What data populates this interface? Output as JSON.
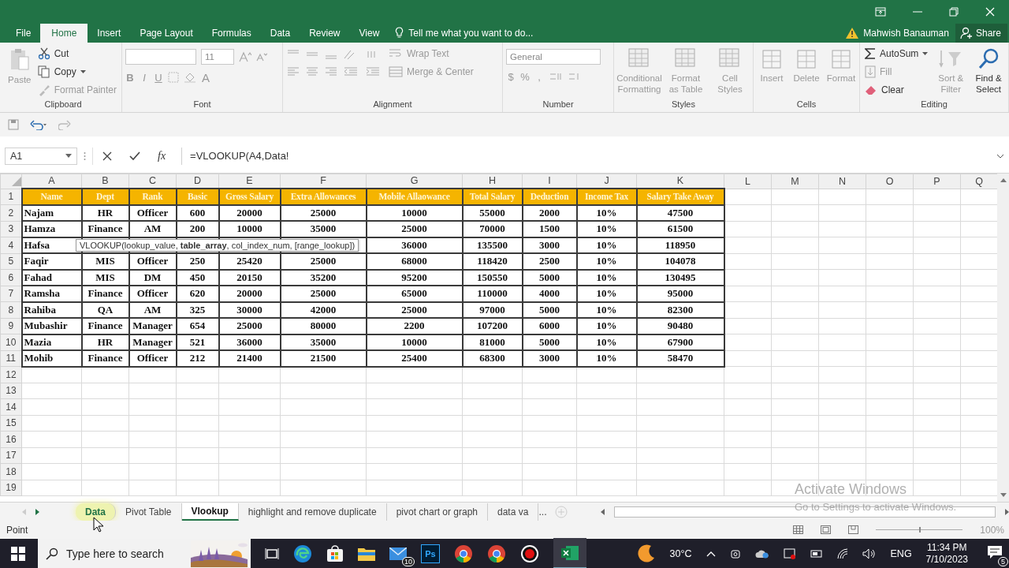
{
  "ribbon_tabs": [
    {
      "label": "File",
      "selected": false
    },
    {
      "label": "Home",
      "selected": true
    },
    {
      "label": "Insert",
      "selected": false
    },
    {
      "label": "Page Layout",
      "selected": false
    },
    {
      "label": "Formulas",
      "selected": false
    },
    {
      "label": "Data",
      "selected": false
    },
    {
      "label": "Review",
      "selected": false
    },
    {
      "label": "View",
      "selected": false
    }
  ],
  "tell_me": "Tell me what you want to do...",
  "user": "Mahwish Banauman",
  "share": "Share",
  "ribbon": {
    "clipboard": {
      "label": "Clipboard",
      "paste": {
        "label": "Paste",
        "disabled": true
      },
      "cut": {
        "label": "Cut",
        "disabled": false
      },
      "copy": {
        "label": "Copy",
        "disabled": false
      },
      "format_painter": {
        "label": "Format Painter",
        "disabled": true
      }
    },
    "font": {
      "label": "Font",
      "font_size": "11",
      "bold": "B",
      "italic": "I",
      "underline": "U",
      "font_color": "A"
    },
    "alignment": {
      "label": "Alignment",
      "wrap_text": "Wrap Text",
      "merge_center": "Merge & Center"
    },
    "number": {
      "label": "Number",
      "format": "General",
      "currency": "$",
      "percent": "%",
      "comma": ","
    },
    "styles": {
      "label": "Styles",
      "commands": [
        "Conditional Formatting",
        "Format as Table",
        "Cell Styles"
      ]
    },
    "cells": {
      "label": "Cells",
      "commands": [
        "Insert",
        "Delete",
        "Format"
      ]
    },
    "editing": {
      "label": "Editing",
      "autosum": {
        "label": "AutoSum",
        "disabled": false
      },
      "fill": {
        "label": "Fill",
        "disabled": true
      },
      "clear": {
        "label": "Clear",
        "disabled": false
      },
      "sort_filter": {
        "label": "Sort & Filter",
        "disabled": true
      },
      "find_select": {
        "label": "Find & Select",
        "disabled": false
      }
    }
  },
  "formula_bar": {
    "name_box": "A1",
    "function_label": "fx",
    "formula": "=VLOOKUP(A4,Data!"
  },
  "tooltip": "VLOOKUP(lookup_value, **table_array**, col_index_num, [range_lookup])",
  "sheet": {
    "columns": [
      "A",
      "B",
      "C",
      "D",
      "E",
      "F",
      "G",
      "H",
      "I",
      "J",
      "K",
      "L",
      "M",
      "N",
      "O",
      "P",
      "Q"
    ],
    "row_numbers": [
      "1",
      "2",
      "3",
      "4",
      "5",
      "6",
      "7",
      "8",
      "9",
      "10",
      "11",
      "12",
      "13",
      "14",
      "15",
      "16",
      "17",
      "18",
      "19"
    ],
    "header": [
      "Name",
      "Dept",
      "Rank",
      "Basic",
      "Gross Salary",
      "Extra Allowances",
      "Mobile Allaowance",
      "Total Salary",
      "Deduction",
      "Income Tax",
      "Salary Take Away"
    ],
    "rows": [
      [
        "Najam",
        "HR",
        "Officer",
        "600",
        "20000",
        "25000",
        "10000",
        "55000",
        "2000",
        "10%",
        "47500"
      ],
      [
        "Hamza",
        "Finance",
        "AM",
        "200",
        "10000",
        "35000",
        "25000",
        "70000",
        "1500",
        "10%",
        "61500"
      ],
      [
        "Hafsa",
        null,
        null,
        null,
        null,
        null,
        "36000",
        "135500",
        "3000",
        "10%",
        "118950"
      ],
      [
        "Faqir",
        "MIS",
        "Officer",
        "250",
        "25420",
        "25000",
        "68000",
        "118420",
        "2500",
        "10%",
        "104078"
      ],
      [
        "Fahad",
        "MIS",
        "DM",
        "450",
        "20150",
        "35200",
        "95200",
        "150550",
        "5000",
        "10%",
        "130495"
      ],
      [
        "Ramsha",
        "Finance",
        "Officer",
        "620",
        "20000",
        "25000",
        "65000",
        "110000",
        "4000",
        "10%",
        "95000"
      ],
      [
        "Rahiba",
        "QA",
        "AM",
        "325",
        "30000",
        "42000",
        "25000",
        "97000",
        "5000",
        "10%",
        "82300"
      ],
      [
        "Mubashir",
        "Finance",
        "Manager",
        "654",
        "25000",
        "80000",
        "2200",
        "107200",
        "6000",
        "10%",
        "90480"
      ],
      [
        "Mazia",
        "HR",
        "Manager",
        "521",
        "36000",
        "35000",
        "10000",
        "81000",
        "5000",
        "10%",
        "67900"
      ],
      [
        "Mohib",
        "Finance",
        "Officer",
        "212",
        "21400",
        "21500",
        "25400",
        "68300",
        "3000",
        "10%",
        "58470"
      ]
    ]
  },
  "sheet_tabs": [
    {
      "label": "Data",
      "selected": false,
      "highlighted": true
    },
    {
      "label": "Pivot Table",
      "selected": false,
      "highlighted": false
    },
    {
      "label": "Vlookup",
      "selected": true,
      "highlighted": false
    },
    {
      "label": "highlight and remove duplicate",
      "selected": false,
      "highlighted": false
    },
    {
      "label": "pivot chart or graph",
      "selected": false,
      "highlighted": false
    },
    {
      "label": "data va",
      "selected": false,
      "highlighted": false
    }
  ],
  "tabs_overflow": "...",
  "status": "Point",
  "zoom": "100%",
  "zoom_slider": {
    "level": 0.5
  },
  "activation": {
    "title": "Activate Windows",
    "hint": "Go to Settings to activate Windows."
  },
  "taskbar": {
    "search_placeholder": "Type here to search",
    "mail_badge": "10",
    "photoshop": "Ps",
    "temperature": "30°C",
    "language": "ENG",
    "time": "11:34 PM",
    "date": "7/10/2023",
    "notifications": "5"
  }
}
